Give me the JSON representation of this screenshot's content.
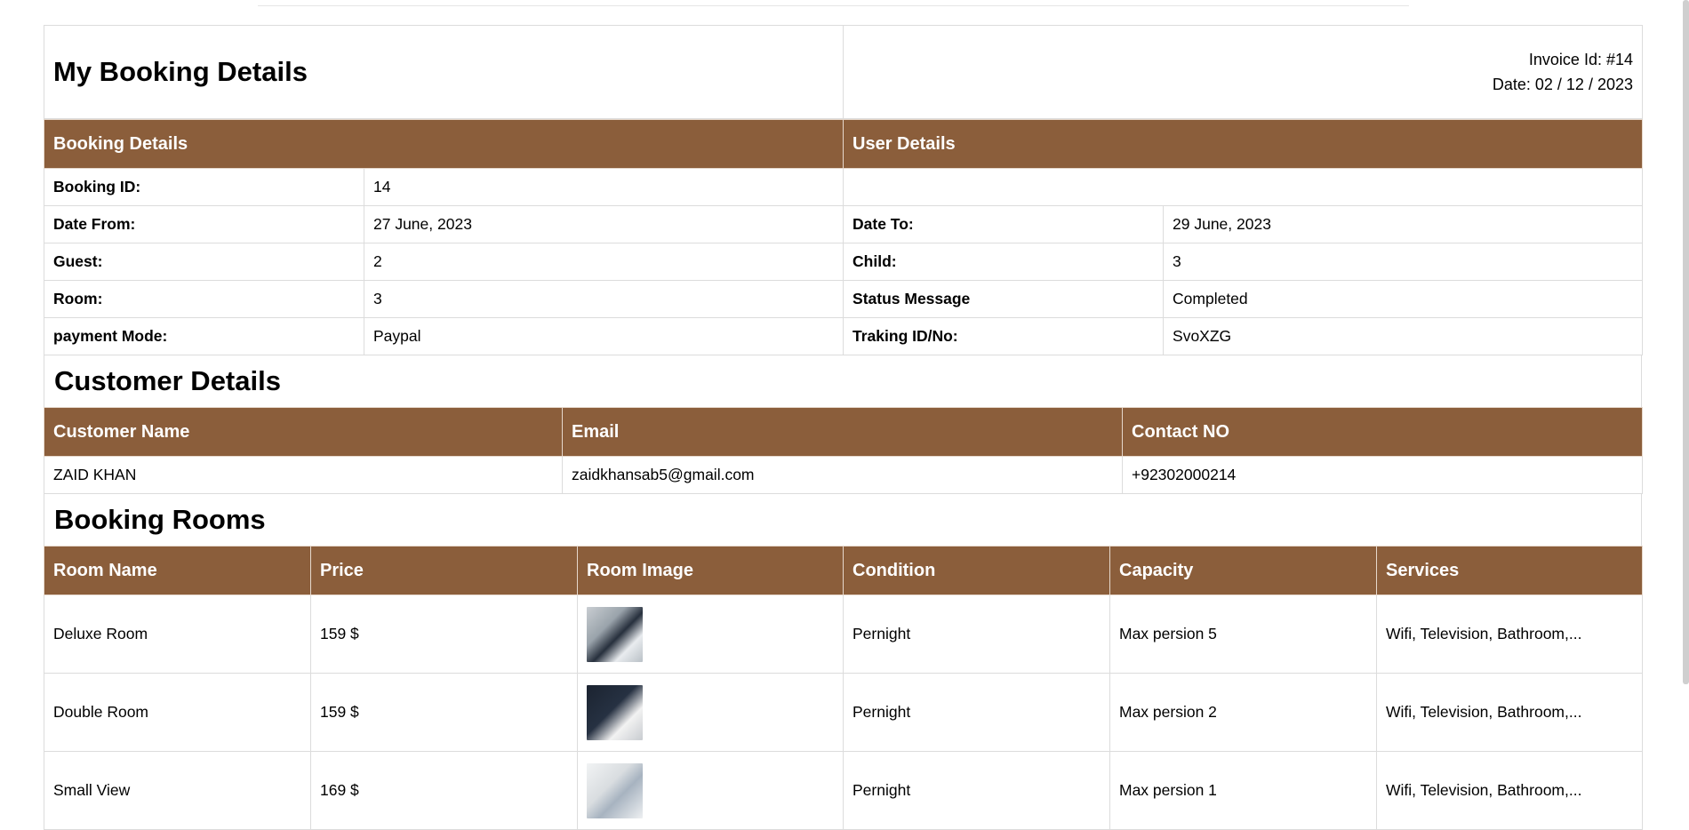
{
  "header": {
    "title": "My Booking Details",
    "invoice_id": "Invoice Id: #14",
    "date": "Date: 02 / 12 / 2023"
  },
  "sections": {
    "booking_details": "Booking Details",
    "user_details": "User Details",
    "customer_details": "Customer Details",
    "booking_rooms": "Booking Rooms"
  },
  "booking": {
    "booking_id_label": "Booking ID:",
    "booking_id": "14",
    "date_from_label": "Date From:",
    "date_from": "27 June, 2023",
    "date_to_label": "Date To:",
    "date_to": "29 June, 2023",
    "guest_label": "Guest:",
    "guest": "2",
    "child_label": "Child:",
    "child": "3",
    "room_label": "Room:",
    "room": "3",
    "status_label": "Status Message",
    "status": "Completed",
    "payment_label": "payment Mode:",
    "payment": "Paypal",
    "tracking_label": "Traking ID/No:",
    "tracking": "SvoXZG"
  },
  "customer": {
    "headers": [
      "Customer Name",
      "Email",
      "Contact NO"
    ],
    "name": "ZAID KHAN",
    "email": "zaidkhansab5@gmail.com",
    "contact": "+92302000214"
  },
  "rooms": {
    "headers": [
      "Room Name",
      "Price",
      "Room Image",
      "Condition",
      "Capacity",
      "Services"
    ],
    "rows": [
      {
        "name": "Deluxe Room",
        "price": "159 $",
        "condition": "Pernight",
        "capacity": "Max persion 5",
        "services": "Wifi, Television, Bathroom,..."
      },
      {
        "name": "Double Room",
        "price": "159 $",
        "condition": "Pernight",
        "capacity": "Max persion 2",
        "services": "Wifi, Television, Bathroom,..."
      },
      {
        "name": "Small View",
        "price": "169 $",
        "condition": "Pernight",
        "capacity": "Max persion 1",
        "services": "Wifi, Television, Bathroom,..."
      }
    ]
  }
}
